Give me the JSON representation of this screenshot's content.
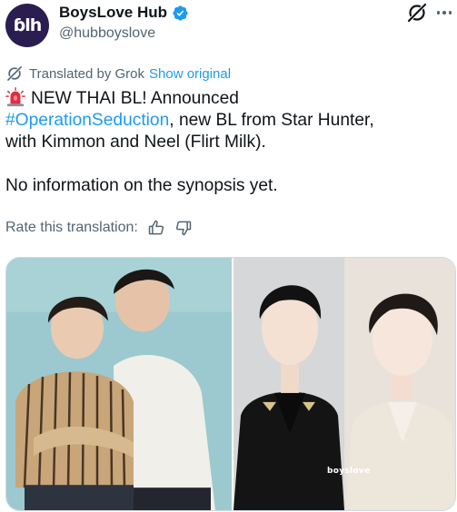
{
  "author": {
    "avatar_text": "ɓlh",
    "display_name": "BoysLove Hub",
    "handle": "@hubboyslove",
    "verified": true
  },
  "icons": {
    "verified": "verified-badge-icon",
    "grok": "grok-icon",
    "more": "more-options-icon",
    "translate": "grok-translate-icon",
    "siren": "rotating-light-emoji",
    "thumbs_up": "thumbs-up-icon",
    "thumbs_down": "thumbs-down-icon"
  },
  "translation": {
    "label": "Translated by Grok",
    "show_original": "Show original",
    "rate_label": "Rate this translation:"
  },
  "tweet": {
    "line1": "NEW THAI BL! Announced",
    "hashtag": "#OperationSeduction",
    "line2_rest": ", new BL from Star Hunter,",
    "line3": "with Kimmon and Neel (Flirt Milk).",
    "line4": "No information on the synopsis yet."
  },
  "media": {
    "watermark": "boyslove"
  },
  "colors": {
    "accent": "#1d9bf0",
    "text": "#0f1419",
    "secondary": "#536471",
    "avatar_bg": "#2a1d4f"
  }
}
